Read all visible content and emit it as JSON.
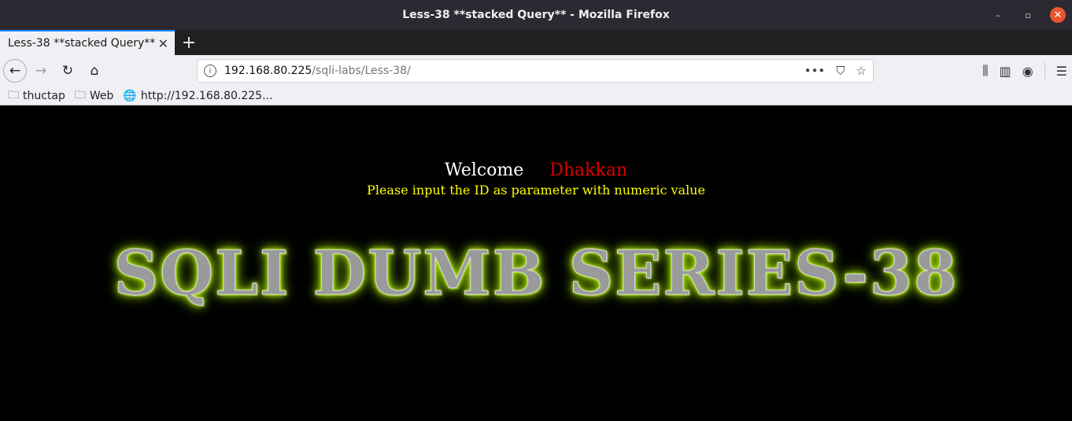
{
  "window": {
    "title": "Less-38 **stacked Query** - Mozilla Firefox",
    "controls": {
      "minimize": "–",
      "restore": "▫",
      "close": "✕"
    }
  },
  "tabs": [
    {
      "label": "Less-38 **stacked Query**",
      "close": "✕"
    }
  ],
  "newtab": "+",
  "nav": {
    "back": "←",
    "forward": "→",
    "reload": "↻",
    "home": "⌂"
  },
  "url": {
    "host": "192.168.80.225",
    "path": "/sqli-labs/Less-38/",
    "info": "i",
    "more": "•••",
    "pocket": "⛉",
    "star": "☆"
  },
  "toolbar": {
    "library": "⫼",
    "sidebar": "▥",
    "account": "◉",
    "menu": "☰"
  },
  "bookmarks": [
    {
      "label": "thuctap",
      "icon": "folder-icon"
    },
    {
      "label": "Web",
      "icon": "folder-icon"
    },
    {
      "label": "http://192.168.80.225...",
      "icon": "globe-icon"
    }
  ],
  "page": {
    "welcome": "Welcome",
    "name": "Dhakkan",
    "prompt": "Please input the ID as parameter with numeric value",
    "banner": "SQLI DUMB SERIES-38"
  },
  "colors": {
    "welcome": "#ffffff",
    "name": "#e00000",
    "prompt": "#ffff00",
    "banner_glow": "#b6f000"
  }
}
